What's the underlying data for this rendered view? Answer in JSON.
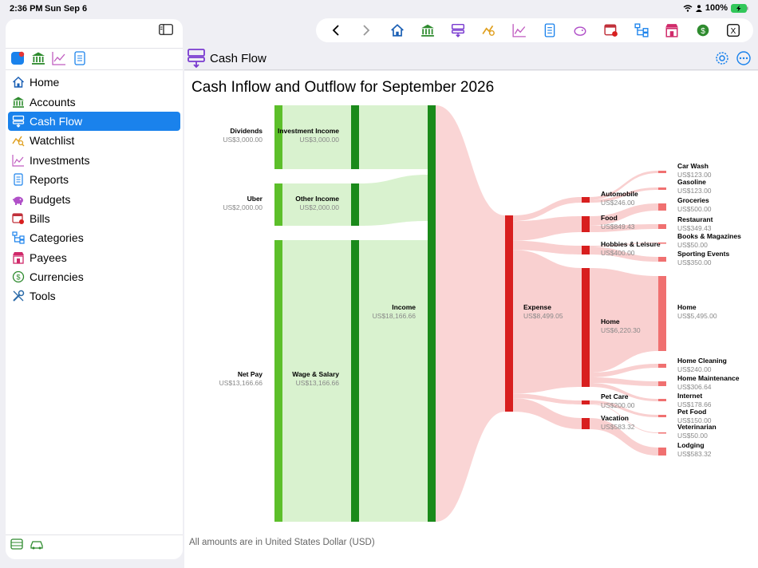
{
  "status_bar": {
    "time": "2:36 PM",
    "date": "Sun Sep 6",
    "battery": "100%"
  },
  "sidebar": {
    "mini_tabs": [
      "app-icon",
      "bank-icon",
      "chart-icon",
      "report-icon"
    ],
    "items": [
      {
        "label": "Home",
        "icon": "house-icon",
        "active": false
      },
      {
        "label": "Accounts",
        "icon": "bank-icon",
        "active": false
      },
      {
        "label": "Cash Flow",
        "icon": "cashflow-icon",
        "active": true
      },
      {
        "label": "Watchlist",
        "icon": "watchlist-icon",
        "active": false
      },
      {
        "label": "Investments",
        "icon": "investment-icon",
        "active": false
      },
      {
        "label": "Reports",
        "icon": "report-icon",
        "active": false
      },
      {
        "label": "Budgets",
        "icon": "piggy-bank-icon",
        "active": false
      },
      {
        "label": "Bills",
        "icon": "bill-icon",
        "active": false
      },
      {
        "label": "Categories",
        "icon": "category-icon",
        "active": false
      },
      {
        "label": "Payees",
        "icon": "store-icon",
        "active": false
      },
      {
        "label": "Currencies",
        "icon": "currency-icon",
        "active": false
      },
      {
        "label": "Tools",
        "icon": "tools-icon",
        "active": false
      }
    ]
  },
  "toolbar": {
    "buttons": [
      "back-icon",
      "forward-icon",
      "house-icon",
      "bank-icon",
      "cashflow-icon",
      "watchlist-icon",
      "investment-icon",
      "report-icon",
      "piggy-bank-icon",
      "bill-icon",
      "category-icon",
      "store-icon",
      "currency-icon",
      "close-icon"
    ],
    "close_label": "X"
  },
  "header": {
    "title": "Cash Flow"
  },
  "report": {
    "title": "Cash Inflow and Outflow for September 2026",
    "footnote": "All amounts are in United States Dollar (USD)"
  },
  "colors": {
    "accent": "#1a82ec",
    "income_source": "#5cbf2a",
    "income_node": "#1a8a1a",
    "income_flow": "#d9f2cf",
    "expense_node": "#d81f1f",
    "expense_leaf": "#f07070",
    "expense_flow": "#f9d0d0"
  },
  "chart_data": {
    "type": "sankey",
    "title": "Cash Inflow and Outflow for September 2026",
    "nodes": [
      {
        "id": "dividends",
        "label": "Dividends",
        "amount": "US$3,000.00",
        "value": 3000
      },
      {
        "id": "uber",
        "label": "Uber",
        "amount": "US$2,000.00",
        "value": 2000
      },
      {
        "id": "netpay",
        "label": "Net Pay",
        "amount": "US$13,166.66",
        "value": 13166.66
      },
      {
        "id": "inv_income",
        "label": "Investment Income",
        "amount": "US$3,000.00",
        "value": 3000
      },
      {
        "id": "other_income",
        "label": "Other Income",
        "amount": "US$2,000.00",
        "value": 2000
      },
      {
        "id": "wage",
        "label": "Wage & Salary",
        "amount": "US$13,166.66",
        "value": 13166.66
      },
      {
        "id": "income",
        "label": "Income",
        "amount": "US$18,166.66",
        "value": 18166.66
      },
      {
        "id": "expense",
        "label": "Expense",
        "amount": "US$8,499.05",
        "value": 8499.05
      },
      {
        "id": "automobile",
        "label": "Automobile",
        "amount": "US$246.00",
        "value": 246
      },
      {
        "id": "food",
        "label": "Food",
        "amount": "US$849.43",
        "value": 849.43
      },
      {
        "id": "hobbies",
        "label": "Hobbies & Leisure",
        "amount": "US$400.00",
        "value": 400
      },
      {
        "id": "home_cat",
        "label": "Home",
        "amount": "US$6,220.30",
        "value": 6220.3
      },
      {
        "id": "petcare",
        "label": "Pet Care",
        "amount": "US$200.00",
        "value": 200
      },
      {
        "id": "vacation",
        "label": "Vacation",
        "amount": "US$583.32",
        "value": 583.32
      },
      {
        "id": "carwash",
        "label": "Car Wash",
        "amount": "US$123.00",
        "value": 123
      },
      {
        "id": "gasoline",
        "label": "Gasoline",
        "amount": "US$123.00",
        "value": 123
      },
      {
        "id": "groceries",
        "label": "Groceries",
        "amount": "US$500.00",
        "value": 500
      },
      {
        "id": "restaurant",
        "label": "Restaurant",
        "amount": "US$349.43",
        "value": 349.43
      },
      {
        "id": "books",
        "label": "Books & Magazines",
        "amount": "US$50.00",
        "value": 50
      },
      {
        "id": "sporting",
        "label": "Sporting Events",
        "amount": "US$350.00",
        "value": 350
      },
      {
        "id": "home_leaf",
        "label": "Home",
        "amount": "US$5,495.00",
        "value": 5495
      },
      {
        "id": "homecleaning",
        "label": "Home Cleaning",
        "amount": "US$240.00",
        "value": 240
      },
      {
        "id": "homemaint",
        "label": "Home Maintenance",
        "amount": "US$306.64",
        "value": 306.64
      },
      {
        "id": "internet",
        "label": "Internet",
        "amount": "US$178.66",
        "value": 178.66
      },
      {
        "id": "petfood",
        "label": "Pet Food",
        "amount": "US$150.00",
        "value": 150
      },
      {
        "id": "vet",
        "label": "Veterinarian",
        "amount": "US$50.00",
        "value": 50
      },
      {
        "id": "lodging",
        "label": "Lodging",
        "amount": "US$583.32",
        "value": 583.32
      }
    ]
  }
}
